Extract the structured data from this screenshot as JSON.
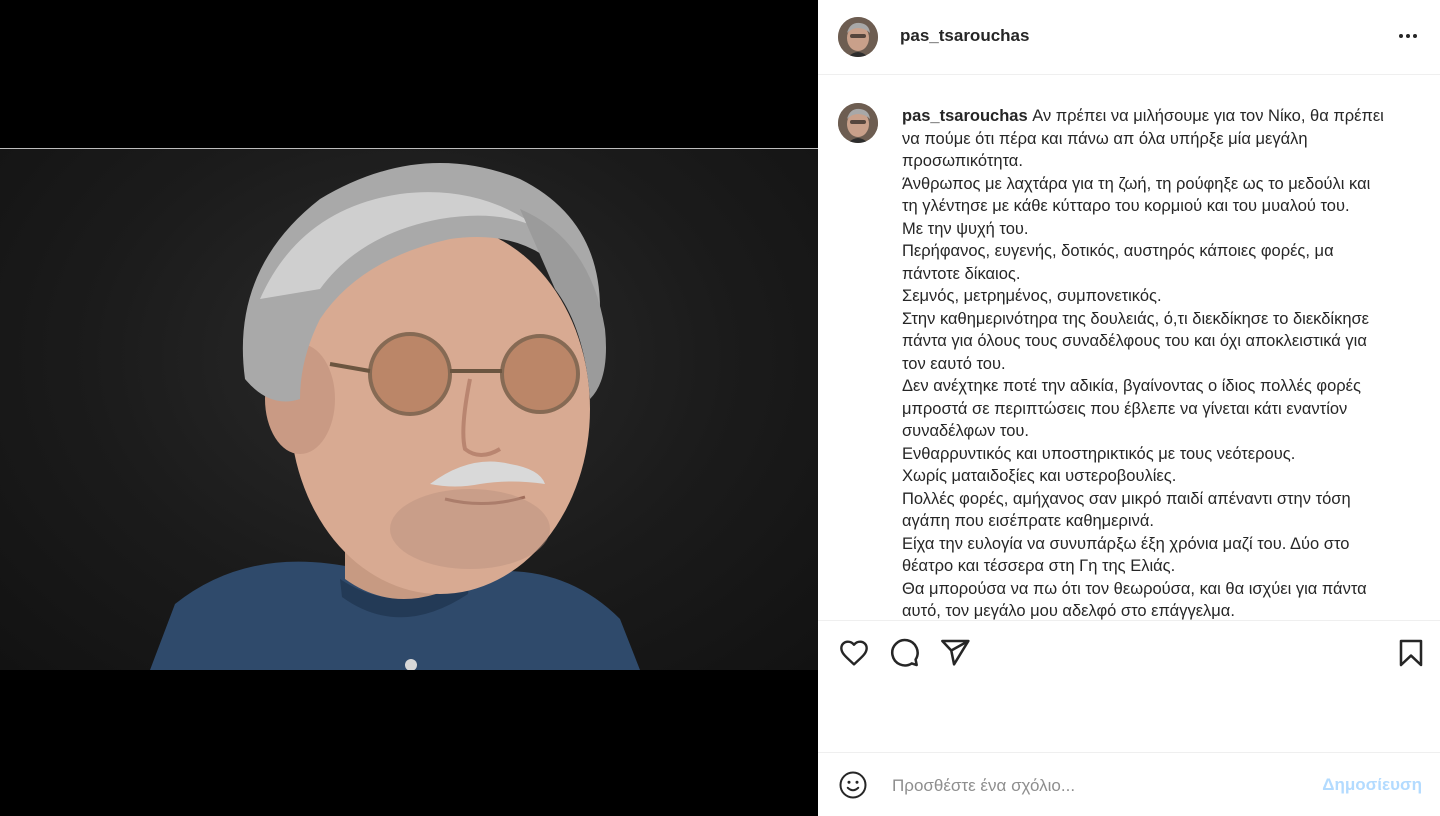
{
  "post": {
    "username": "pas_tsarouchas",
    "more_icon": "more-horizontal-icon"
  },
  "caption": {
    "username": "pas_tsarouchas",
    "lines": [
      "Αν πρέπει να μιλήσουμε για τον Νίκο, θα πρέπει",
      "να πούμε ότι πέρα και πάνω απ όλα υπήρξε μία μεγάλη",
      "προσωπικότητα.",
      "Άνθρωπος με λαχτάρα για τη ζωή, τη ρούφηξε ως το μεδούλι και",
      "τη γλέντησε με κάθε κύτταρο του κορμιού και του μυαλού του.",
      "Με την ψυχή του.",
      "Περήφανος, ευγενής, δοτικός, αυστηρός κάποιες φορές, μα",
      "πάντοτε δίκαιος.",
      "Σεμνός, μετρημένος, συμπονετικός.",
      "Στην καθημερινότηρα της δουλειάς, ό,τι διεκδίκησε το διεκδίκησε",
      "πάντα για όλους τους συναδέλφους του και όχι αποκλειστικά για",
      "τον εαυτό του.",
      "Δεν ανέχτηκε ποτέ την αδικία, βγαίνοντας ο ίδιος πολλές φορές",
      "μπροστά σε περιπτώσεις που έβλεπε να γίνεται κάτι εναντίον",
      "συναδέλφων του.",
      "Ενθαρρυντικός και υποστηρικτικός με τους νεότερους.",
      "Χωρίς ματαιδοξίες και υστεροβουλίες.",
      "Πολλές φορές, αμήχανος σαν μικρό παιδί απέναντι στην τόση",
      "αγάπη που εισέπρατε καθημερινά.",
      "Είχα την ευλογία να συνυπάρξω έξη χρόνια μαζί του. Δύο στο",
      "θέατρο και τέσσερα στη Γη της Ελιάς.",
      "Θα μπορούσα να πω ότι τον θεωρούσα, και θα ισχύει για πάντα",
      "αυτό, τον μεγάλο μου αδελφό στο επάγγελμα."
    ]
  },
  "actions": {
    "icons": [
      "heart-icon",
      "comment-icon",
      "share-icon",
      "bookmark-icon"
    ]
  },
  "comment_box": {
    "placeholder": "Προσθέστε ένα σχόλιο...",
    "post_label": "Δημοσίευση",
    "post_color": "#b3dbff"
  }
}
